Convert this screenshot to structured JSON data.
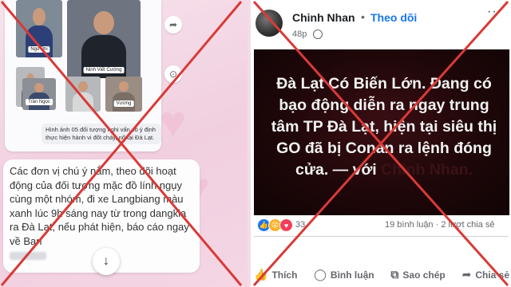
{
  "left": {
    "photos": [
      {
        "caption": "Ngo Phi"
      },
      {
        "caption": "Ninh Viết Cường"
      },
      {
        "caption": ""
      },
      {
        "caption": "Trần Ngọc"
      },
      {
        "caption": ""
      },
      {
        "caption": "Vương"
      }
    ],
    "photo_caption": "Hình ảnh 05 đối tượng nghi vấn có ý định thực hiện hành vi đốt cháy, nổ tại Đà Lạt.",
    "message": "Các đơn vị chú ý nắm, theo dõi hoạt động của đối tượng mặc đồ lính ngụy cùng một nhóm, đi xe Langbiang màu xanh lúc 9h sáng nay từ trong dangkia ra Đà Lạt, nếu phát hiện, báo cáo ngay về Ban",
    "icons": {
      "share": "share-arrow-icon",
      "more": "more-icon",
      "scroll_down": "arrow-down-icon"
    }
  },
  "right": {
    "author": "Chinh Nhan",
    "separator": "•",
    "follow": "Theo dõi",
    "more": "···",
    "time": "48p",
    "post_text_main": "Đà Lạt Có Biến Lớn. Đang có bạo động diễn ra ngay trung tâm TP Đà Lạt, hiện tại siêu thị GO đã bị Conan ra lệnh đóng cửa. — với ",
    "post_text_mention": "Chinh Nhan.",
    "reaction_count": "33",
    "stats": "19 bình luận · 2 lượt chia sẻ",
    "actions": [
      {
        "label": "Thích",
        "icon": "like-icon"
      },
      {
        "label": "Bình luận",
        "icon": "comment-icon"
      },
      {
        "label": "Sao chép",
        "icon": "copy-icon"
      },
      {
        "label": "Chia sẻ",
        "icon": "share-icon"
      }
    ]
  },
  "colors": {
    "cross": "#d93a37",
    "facebook_blue": "#1877f2",
    "post_bg": "#1e0709"
  }
}
